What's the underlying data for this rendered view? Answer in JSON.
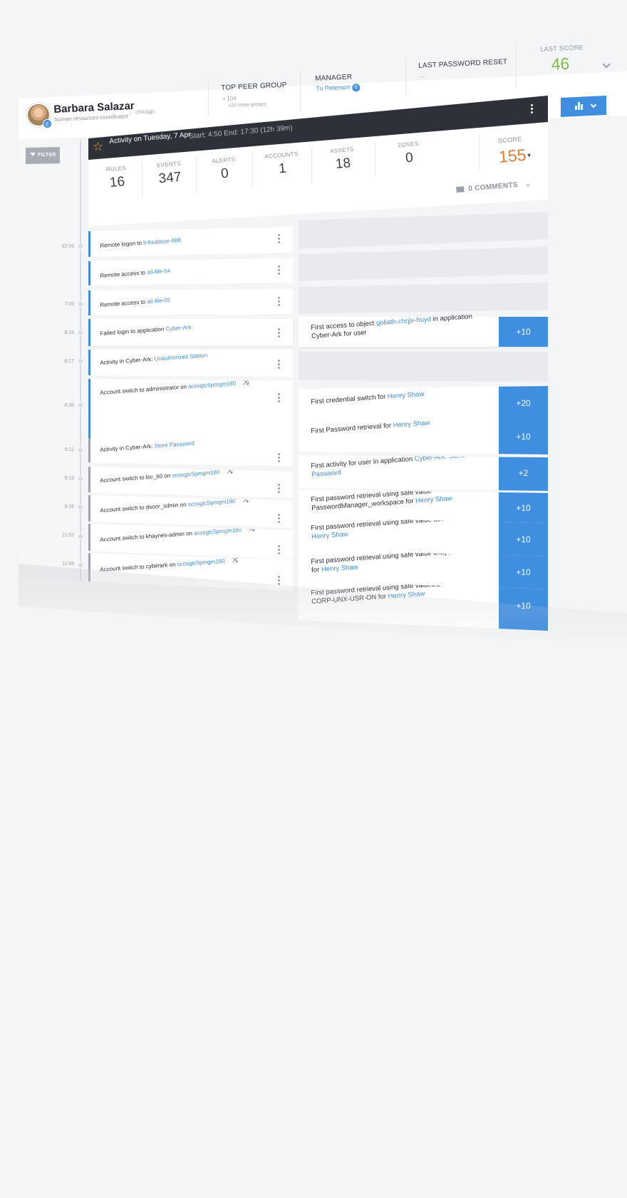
{
  "user": {
    "name": "Barbara Salazar",
    "role": "human resources coordinator",
    "location": "chicago"
  },
  "header": {
    "peer_group_label": "TOP PEER GROUP",
    "peer_group_count": "104",
    "peer_group_more": "+20 more groups",
    "manager_label": "MANAGER",
    "manager_name": "Tu Peterson",
    "password_reset_label": "LAST PASSWORD RESET",
    "password_reset_value": "—",
    "last_score_label": "LAST SCORE",
    "last_score_value": "46"
  },
  "filter_label": "FILTER",
  "activity": {
    "title": "Activity on Tuesday, 7 Apr",
    "time_range": "Start: 4:50 End: 17:30 (12h 39m)",
    "stats": [
      {
        "label": "RULES",
        "value": "16"
      },
      {
        "label": "EVENTS",
        "value": "347"
      },
      {
        "label": "ALERTS",
        "value": "0"
      },
      {
        "label": "ACCOUNTS",
        "value": "1"
      },
      {
        "label": "ASSETS",
        "value": "18"
      },
      {
        "label": "ZONES",
        "value": "0"
      }
    ],
    "score_label": "SCORE",
    "score_value": "155",
    "comments": "0 COMMENTS"
  },
  "times": [
    "22:09",
    "7:05",
    "8:16",
    "8:17",
    "8:36",
    "9:11",
    "9:13",
    "9:16",
    "11:52",
    "11:56"
  ],
  "events": [
    {
      "text": "Remote logon to ",
      "link": "lt-bsalazar-888"
    },
    {
      "text": "Remote access to ",
      "link": "atl-file-54"
    },
    {
      "text": "Remote access to ",
      "link": "atl-file-02"
    },
    {
      "text": "Failed login to application ",
      "link": "Cyber-Ark"
    },
    {
      "text": "Activity in Cyber-Ark: ",
      "link": "Unauthorized Station"
    },
    {
      "text": "Account switch to administrator on ",
      "link": "scosgtc5pmgm180"
    },
    {
      "text": "Activity in Cyber-Ark: ",
      "link": "Store Password"
    },
    {
      "text": "Account switch to loc_60 on ",
      "link": "scosgtc5pmgm180"
    },
    {
      "text": "Account switch to dsoor_sdmin on ",
      "link": "scosgtc5pmgm180"
    },
    {
      "text": "Account switch to khaynes-admin on ",
      "link": "scosgtc5pmgm180"
    },
    {
      "text": "Account switch to cyberark on ",
      "link": "scosgtc5pmgm180"
    }
  ],
  "scores": [
    {
      "pre": "First access to object ",
      "link": "goliath-chrjjv-huyd",
      "post": " in application Cyber-Ark for user",
      "points": "+10"
    },
    {
      "pre": "First credential switch for ",
      "link": "Henry Shaw",
      "post": "",
      "points": "+20"
    },
    {
      "pre": "First Password retrieval for ",
      "link": "Henry Shaw",
      "post": "",
      "points": "+10"
    },
    {
      "pre": "First activity for user in application ",
      "link": "Cyber-Ark: Store Password",
      "post": "",
      "points": "+2"
    },
    {
      "pre": "First password retrieval using safe value PasswordManager_workspace for ",
      "link": "Henry Shaw",
      "post": "",
      "points": "+10"
    },
    {
      "pre": "First password retrieval using safe value dsoor-admin for ",
      "link": "Henry Shaw",
      "post": "",
      "points": "+10"
    },
    {
      "pre": "First password retrieval using safe value khaynes-admin for ",
      "link": "Henry Shaw",
      "post": "",
      "points": "+10"
    },
    {
      "pre": "First password retrieval using safe valueSER-GBR-CORP-UNX-USR-ON for ",
      "link": "Henry Shaw",
      "post": "",
      "points": "+10"
    }
  ],
  "colors": {
    "accent": "#3f8ee0",
    "score_orange": "#dd7b33",
    "last_score_green": "#7dbb4a",
    "dark_header": "#2f3139"
  },
  "icons": [
    "star-icon",
    "kebab-icon",
    "switch-icon",
    "comment-icon",
    "filter-icon",
    "bar-chart-icon",
    "chevron-down-icon",
    "phone-icon"
  ]
}
